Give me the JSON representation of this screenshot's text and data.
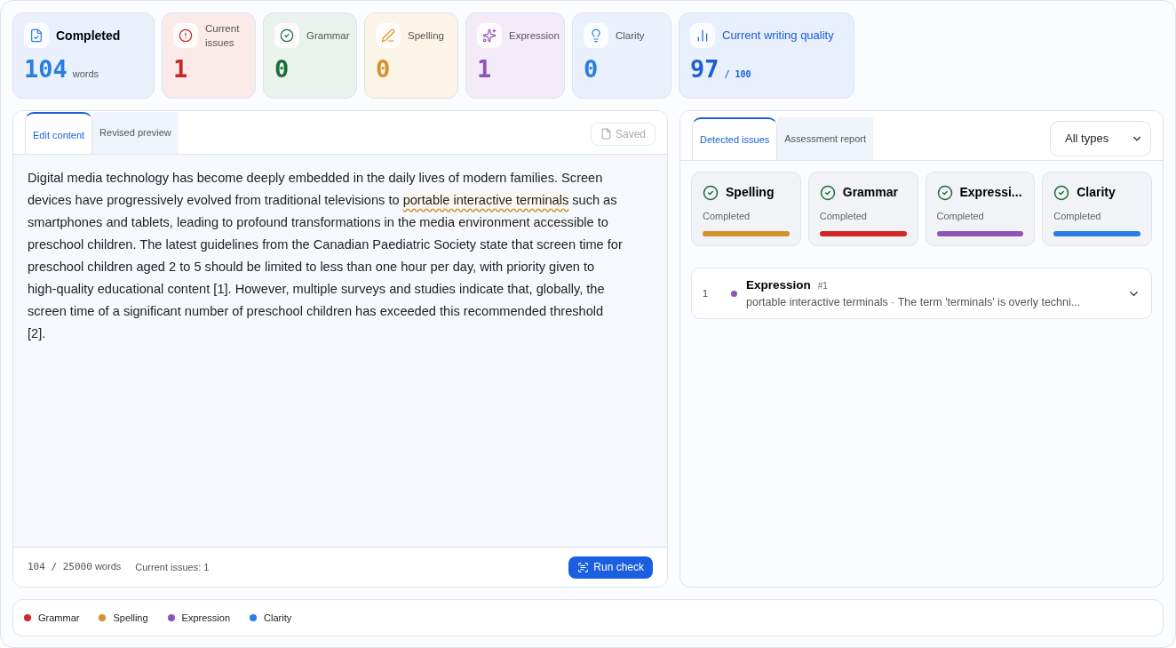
{
  "stats": [
    {
      "kind": "words",
      "label": "Completed",
      "value": "104",
      "unit": "words",
      "color": "#2a7de1"
    },
    {
      "kind": "issues",
      "label": "Current issues",
      "value": "1",
      "color": "#c62828"
    },
    {
      "kind": "grammar",
      "label": "Grammar",
      "value": "0",
      "color": "#1e6b3a"
    },
    {
      "kind": "spelling",
      "label": "Spelling",
      "value": "0",
      "color": "#d4922a"
    },
    {
      "kind": "expression",
      "label": "Expression",
      "value": "1",
      "color": "#8e55b8"
    },
    {
      "kind": "clarity",
      "label": "Clarity",
      "value": "0",
      "color": "#2a7de1"
    },
    {
      "kind": "quality",
      "label": "Current writing quality",
      "value": "97",
      "unit": "/ 100",
      "color": "#1a5fd6"
    }
  ],
  "editor": {
    "tabs": [
      {
        "label": "Edit content",
        "selected": true
      },
      {
        "label": "Revised preview",
        "selected": false
      }
    ],
    "saved": "Saved",
    "segments": [
      {
        "text": "Digital media technology has become deeply embedded in the daily lives of modern families. Screen devices have progressively evolved from traditional televisions to ",
        "flagged": false
      },
      {
        "text": "portable interactive terminals",
        "flagged": true
      },
      {
        "text": " such as smartphones and tablets, leading to profound transformations in the media environment accessible to preschool children. The latest guidelines from the Canadian Paediatric Society state that screen time for preschool children aged 2 to 5 should be limited to less than one hour per day, with priority given to high-quality educational content [1]. However, multiple surveys and studies indicate that, globally, the screen time of a significant number of preschool children has exceeded this recommended threshold [2].",
        "flagged": false
      }
    ],
    "word_count": "104 / 25000",
    "word_unit": "words",
    "issues": "Current issues: 1",
    "run_button": "Run check"
  },
  "results": {
    "tabs": [
      {
        "label": "Detected issues",
        "selected": true
      },
      {
        "label": "Assessment report",
        "selected": false
      }
    ],
    "filter": "All types",
    "checks": [
      {
        "name": "Spelling",
        "status": "Completed",
        "color": "#d4922a",
        "level": 1
      },
      {
        "name": "Grammar",
        "status": "Completed",
        "color": "#d32626",
        "level": 1
      },
      {
        "name": "Expressi...",
        "status": "Completed",
        "color": "#8e55b8",
        "level": 1
      },
      {
        "name": "Clarity",
        "status": "Completed",
        "color": "#2a7de1",
        "level": 1
      }
    ],
    "issues": [
      {
        "index": "1",
        "color": "#8e55b8",
        "type": "Expression",
        "number": "#1",
        "summary": "portable interactive terminals · The term 'terminals' is overly techni...",
        "expanded": false
      }
    ]
  },
  "legend": [
    {
      "label": "Grammar",
      "color": "#d32626"
    },
    {
      "label": "Spelling",
      "color": "#d4922a"
    },
    {
      "label": "Expression",
      "color": "#8e55b8"
    },
    {
      "label": "Clarity",
      "color": "#2a7de1"
    }
  ]
}
